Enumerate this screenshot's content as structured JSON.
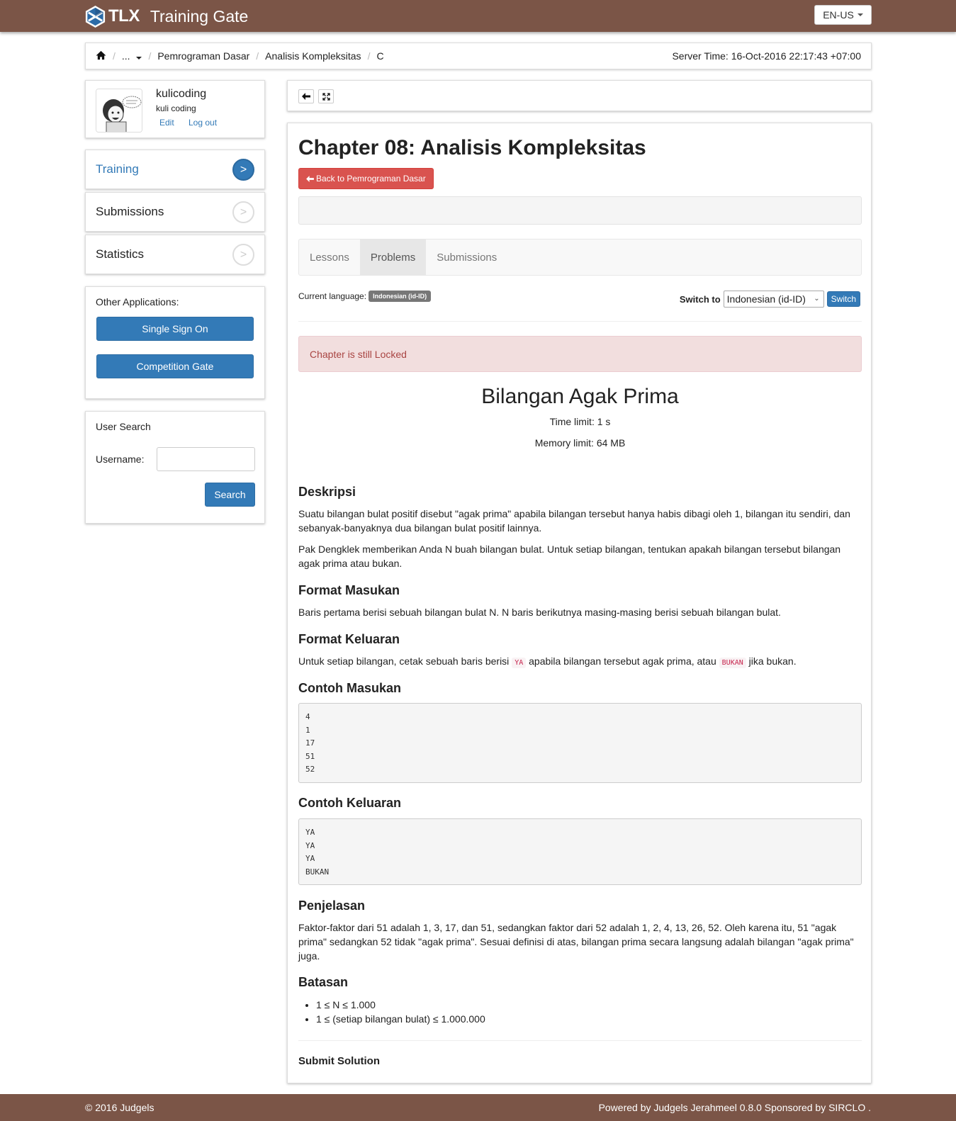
{
  "header": {
    "logo_text": "TLX",
    "app_name": "Training Gate",
    "language_button": "EN-US"
  },
  "breadcrumb": {
    "items": [
      "...",
      "Pemrograman Dasar",
      "Analisis Kompleksitas",
      "C"
    ],
    "server_time": "Server Time: 16-Oct-2016 22:17:43 +07:00"
  },
  "profile": {
    "username": "kulicoding",
    "full_name": "kuli coding",
    "edit_label": "Edit",
    "logout_label": "Log out"
  },
  "sidebar": {
    "items": [
      {
        "label": "Training",
        "active": true
      },
      {
        "label": "Submissions",
        "active": false
      },
      {
        "label": "Statistics",
        "active": false
      }
    ],
    "chevron": ">"
  },
  "other_apps": {
    "title": "Other Applications:",
    "buttons": [
      "Single Sign On",
      "Competition Gate"
    ]
  },
  "user_search": {
    "title": "User Search",
    "username_label": "Username:",
    "input_value": "",
    "search_button": "Search"
  },
  "chapter": {
    "title": "Chapter 08: Analisis Kompleksitas",
    "back_button": "Back to Pemrograman Dasar",
    "tabs": [
      {
        "label": "Lessons",
        "active": false
      },
      {
        "label": "Problems",
        "active": true
      },
      {
        "label": "Submissions",
        "active": false
      }
    ],
    "current_language_label": "Current language:",
    "current_language_badge": "Indonesian (id-ID)",
    "switch_label": "Switch to",
    "switch_selected": "Indonesian (id-ID)",
    "switch_button": "Switch",
    "alert": "Chapter is still Locked"
  },
  "problem": {
    "title": "Bilangan Agak Prima",
    "time_limit": "Time limit: 1 s",
    "memory_limit": "Memory limit: 64 MB",
    "deskripsi_heading": "Deskripsi",
    "deskripsi_p1": "Suatu bilangan bulat positif disebut \"agak prima\" apabila bilangan tersebut hanya habis dibagi oleh 1, bilangan itu sendiri, dan sebanyak-banyaknya dua bilangan bulat positif lainnya.",
    "deskripsi_p2": "Pak Dengklek memberikan Anda N buah bilangan bulat. Untuk setiap bilangan, tentukan apakah bilangan tersebut bilangan agak prima atau bukan.",
    "format_masukan_heading": "Format Masukan",
    "format_masukan_text": "Baris pertama berisi sebuah bilangan bulat N. N baris berikutnya masing-masing berisi sebuah bilangan bulat.",
    "format_keluaran_heading": "Format Keluaran",
    "format_keluaran_before": "Untuk setiap bilangan, cetak sebuah baris berisi",
    "format_keluaran_code1": "YA",
    "format_keluaran_middle": "apabila bilangan tersebut agak prima, atau",
    "format_keluaran_code2": "BUKAN",
    "format_keluaran_after": "jika bukan.",
    "contoh_masukan_heading": "Contoh Masukan",
    "contoh_masukan": "4\n1\n17\n51\n52",
    "contoh_keluaran_heading": "Contoh Keluaran",
    "contoh_keluaran": "YA\nYA\nYA\nBUKAN",
    "penjelasan_heading": "Penjelasan",
    "penjelasan_text": "Faktor-faktor dari 51 adalah 1, 3, 17, dan 51, sedangkan faktor dari 52 adalah 1, 2, 4, 13, 26, 52. Oleh karena itu, 51 \"agak prima\" sedangkan 52 tidak \"agak prima\". Sesuai definisi di atas, bilangan prima secara langsung adalah bilangan \"agak prima\" juga.",
    "batasan_heading": "Batasan",
    "batasan": [
      "1 ≤ N ≤ 1.000",
      "1 ≤ (setiap bilangan bulat) ≤ 1.000.000"
    ],
    "submit_heading": "Submit Solution"
  },
  "footer": {
    "left": "© 2016 Judgels",
    "right": "Powered by Judgels Jerahmeel 0.8.0 Sponsored by SIRCLO ."
  },
  "colors": {
    "brand_brown": "#7b5547",
    "primary_blue": "#337ab7",
    "danger_red": "#d9534f",
    "alert_bg": "#f2dede"
  }
}
